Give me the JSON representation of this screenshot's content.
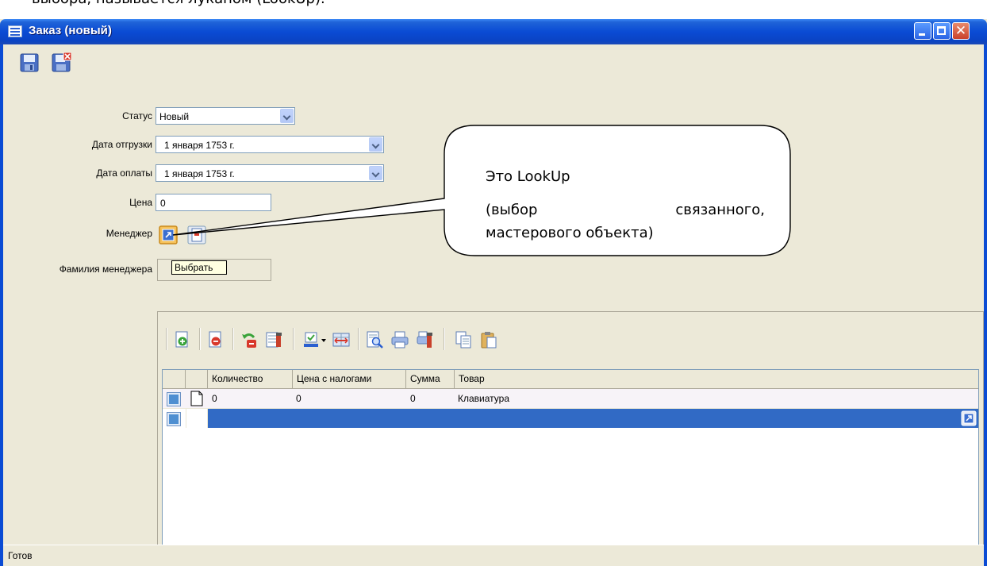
{
  "document": {
    "caption_top": "выбора, называется лукапом (LookUp)."
  },
  "window": {
    "title": "Заказ (новый)",
    "controls": [
      "minimize-icon",
      "maximize-icon",
      "close-icon"
    ],
    "close_glyph": "✕",
    "toolbar": [
      {
        "icon": "save-icon"
      },
      {
        "icon": "save-close-icon"
      }
    ]
  },
  "form": {
    "status_label": "Статус",
    "status_value": "Новый",
    "ship_date_label": "Дата отгрузки",
    "ship_date_value": "1  января  1753 г.",
    "pay_date_label": "Дата оплаты",
    "pay_date_value": "1  января  1753 г.",
    "price_label": "Цена",
    "price_value": "0",
    "manager_label": "Менеджер",
    "manager_surname_label": "Фамилия менеджера",
    "manager_surname_value": ""
  },
  "tooltip": {
    "text": "Выбрать"
  },
  "callout": {
    "title": "Это LookUp",
    "line1_a": "(выбор",
    "line1_b": "связанного,",
    "line2": "мастерового объекта)"
  },
  "grid": {
    "toolbar_icons": [
      "add-row-icon",
      "delete-row-icon",
      "undo-icon",
      "settings-icon",
      "color-filter-icon",
      "dropdown-arrow-icon",
      "column-width-icon",
      "preview-icon",
      "print-icon",
      "print-settings-icon",
      "copy-icon",
      "paste-icon"
    ],
    "columns": [
      "Количество",
      "Цена с налогами",
      "Сумма",
      "Товар"
    ],
    "rows": [
      {
        "cells": [
          "0",
          "0",
          "0",
          "Клавиатура"
        ]
      }
    ],
    "colors": {
      "selected_row": "#316ac5",
      "header": "#ece9d8"
    }
  },
  "statusbar": {
    "text": "Готов"
  },
  "colors": {
    "titlebar": "#0a4bd4",
    "window_bg": "#ece9d8",
    "tooltip_bg": "#ffffe1"
  }
}
